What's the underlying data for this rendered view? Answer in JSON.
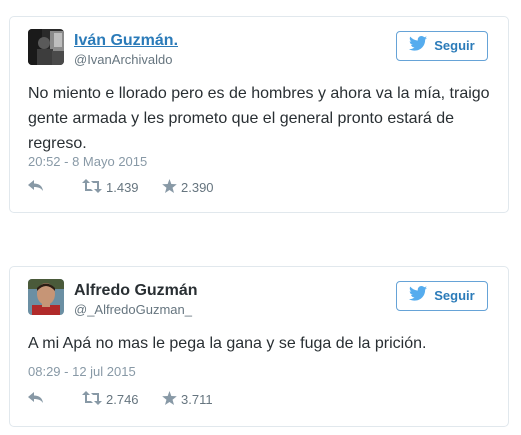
{
  "tweets": [
    {
      "user": {
        "name": "Iván Guzmán.",
        "handle": "@IvanArchivaldo"
      },
      "follow_label": "Seguir",
      "text": "No miento e llorado pero es de hombres y ahora va la mía, traigo gente armada y les prometo que el general pronto estará de regreso.",
      "timestamp": "20:52 - 8 Mayo 2015",
      "retweets": "1.439",
      "likes": "2.390"
    },
    {
      "user": {
        "name": "Alfredo Guzmán",
        "handle": "@_AlfredoGuzman_"
      },
      "follow_label": "Seguir",
      "text": "A mi Apá no mas le pega la gana y se fuga de la prición.",
      "timestamp": "08:29 - 12 jul 2015",
      "retweets": "2.746",
      "likes": "3.711"
    }
  ],
  "colors": {
    "link": "#2b7bb9",
    "text": "#292f33",
    "muted": "#8899a6",
    "border": "#e1e8ed",
    "twitter_blue": "#55acee"
  },
  "icons": [
    "twitter-bird-icon",
    "reply-icon",
    "retweet-icon",
    "star-icon"
  ]
}
